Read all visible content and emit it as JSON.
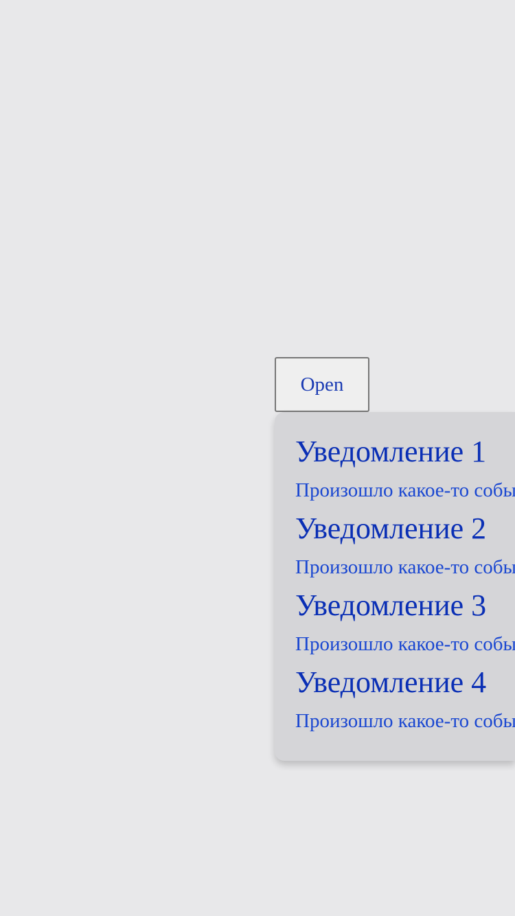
{
  "open_button": {
    "label": "Open"
  },
  "notifications": [
    {
      "title": "Уведомление 1",
      "text": "Произошло какое-то событие"
    },
    {
      "title": "Уведомление 2",
      "text": "Произошло какое-то событие"
    },
    {
      "title": "Уведомление 3",
      "text": "Произошло какое-то событие"
    },
    {
      "title": "Уведомление 4",
      "text": "Произошло какое-то событие"
    }
  ],
  "colors": {
    "background": "#e8e8ea",
    "popover_background": "#d5d5d8",
    "title_text": "#0a2fb5",
    "body_text": "#1a47d1",
    "button_background": "#efefef",
    "button_border": "#767676"
  }
}
